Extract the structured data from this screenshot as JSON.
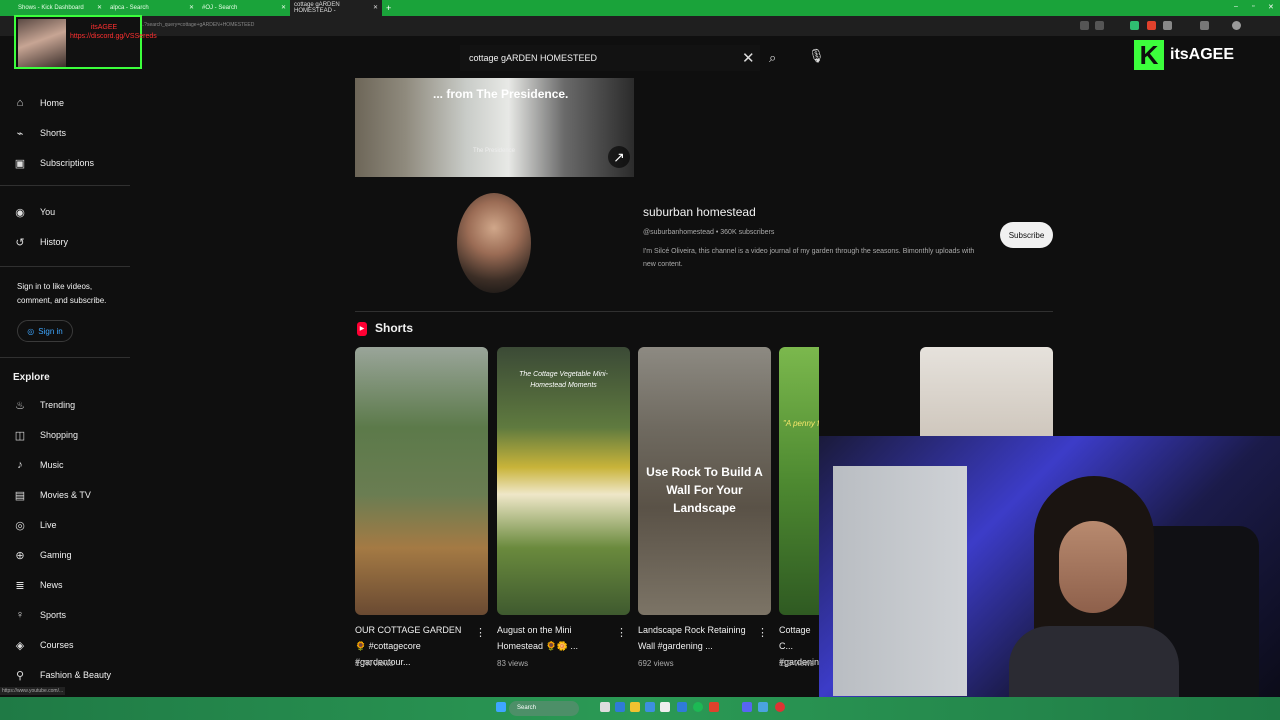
{
  "browser": {
    "tabs": [
      {
        "label": "Shows - Kick Dashboard",
        "active": false
      },
      {
        "label": "alpca - Search",
        "active": false
      },
      {
        "label": "#OJ - Search",
        "active": false
      },
      {
        "label": "cottage gARDEN HOMESTEAD -",
        "active": true
      }
    ],
    "url": "...?search_query=cottage+gARDEN+HOMESTEED"
  },
  "overlay": {
    "webcam_text": "itsAGEE https://discord.gg/VSSereds",
    "brand_name": "itsAGEE",
    "brand_letter": "K"
  },
  "search": {
    "value": "cottage gARDEN HOMESTEED"
  },
  "sidebar": {
    "items": [
      {
        "label": "Home",
        "icon": "home-icon"
      },
      {
        "label": "Shorts",
        "icon": "shorts-icon"
      },
      {
        "label": "Subscriptions",
        "icon": "subscriptions-icon"
      },
      {
        "label": "You",
        "icon": "you-icon"
      },
      {
        "label": "History",
        "icon": "history-icon"
      }
    ],
    "signin_prompt": "Sign in to like videos, comment, and subscribe.",
    "signin_label": "Sign in",
    "explore_title": "Explore",
    "explore": [
      {
        "label": "Trending",
        "icon": "trending-icon"
      },
      {
        "label": "Shopping",
        "icon": "shopping-icon"
      },
      {
        "label": "Music",
        "icon": "music-icon"
      },
      {
        "label": "Movies & TV",
        "icon": "movies-icon"
      },
      {
        "label": "Live",
        "icon": "live-icon"
      },
      {
        "label": "Gaming",
        "icon": "gaming-icon"
      },
      {
        "label": "News",
        "icon": "news-icon"
      },
      {
        "label": "Sports",
        "icon": "sports-icon"
      },
      {
        "label": "Courses",
        "icon": "courses-icon"
      },
      {
        "label": "Fashion & Beauty",
        "icon": "fashion-icon"
      }
    ]
  },
  "ad": {
    "text": "... from The Presidence.",
    "logo": "The Presidence"
  },
  "channel": {
    "name": "suburban homestead",
    "meta": "@suburbanhomestead • 360K subscribers",
    "description": "I'm Silcé Oliveira, this channel is a video journal of my garden through the seasons. Bimonthly uploads with new content.",
    "subscribe_label": "Subscribe"
  },
  "shorts": {
    "title": "Shorts",
    "items": [
      {
        "title": "OUR COTTAGE GARDEN 🌻 #cottagecore #gardentour...",
        "views": "1.7K views",
        "overlay": ""
      },
      {
        "title": "August on the Mini Homestead 🌻🌼 ...",
        "views": "83 views",
        "overlay": "The Cottage Vegetable Mini-Homestead Moments"
      },
      {
        "title": "Landscape Rock Retaining Wall #gardening ...",
        "views": "692 views",
        "overlay": "Use Rock To Build A Wall For Your Landscape"
      },
      {
        "title": "Cottage C... #gardenin...",
        "views": "110 views",
        "overlay": "\"A penny for your thoughts?\""
      },
      {
        "title": "",
        "views": "",
        "overlay": ""
      }
    ]
  },
  "taskbar": {
    "search_label": "Search",
    "status_url": "https://www.youtube.com/..."
  }
}
